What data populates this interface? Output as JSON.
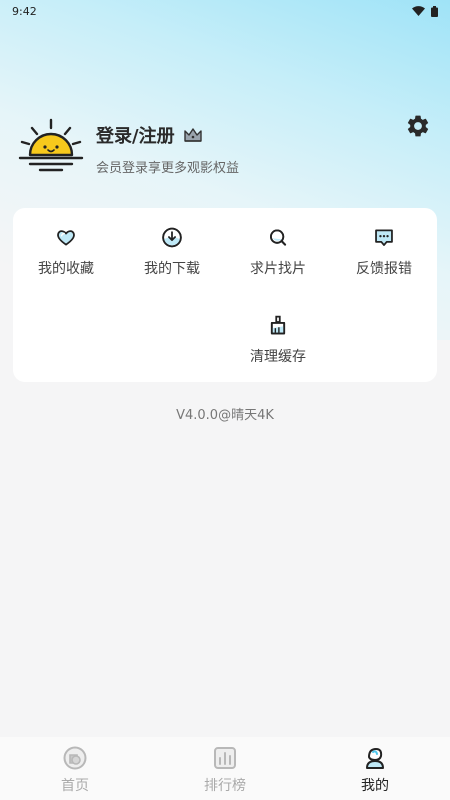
{
  "status_bar": {
    "time": "9:42"
  },
  "profile": {
    "login_label": "登录/注册",
    "subtitle": "会员登录享更多观影权益"
  },
  "menu": {
    "favorites": "我的收藏",
    "downloads": "我的下载",
    "request": "求片找片",
    "feedback": "反馈报错",
    "clear_cache": "清理缓存"
  },
  "version": "V4.0.0@晴天4K",
  "tabs": [
    {
      "label": "首页",
      "icon": "home-icon",
      "active": false
    },
    {
      "label": "排行榜",
      "icon": "ranking-icon",
      "active": false
    },
    {
      "label": "我的",
      "icon": "profile-icon",
      "active": true
    }
  ],
  "colors": {
    "accent": "#4fc8ef",
    "sun": "#f7c91c",
    "text_dark": "#2a2a2a"
  }
}
